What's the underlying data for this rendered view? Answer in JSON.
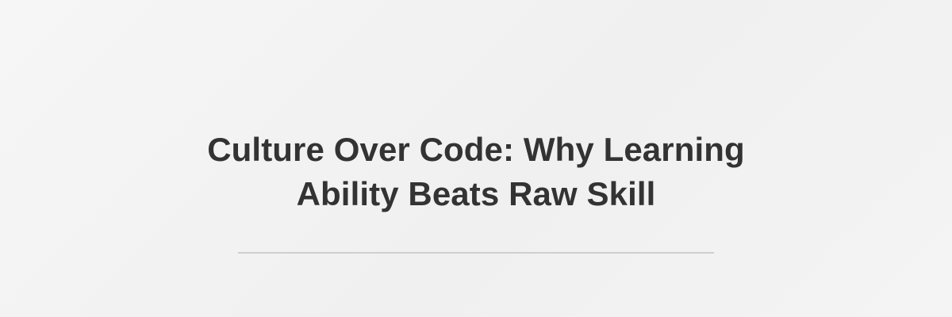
{
  "header": {
    "title_line1": "Culture Over Code: Why Learning",
    "title_line2": "Ability Beats Raw Skill"
  },
  "colors": {
    "title_text": "#333333",
    "divider": "#cfcfcf",
    "background": "#f2f2f2"
  }
}
